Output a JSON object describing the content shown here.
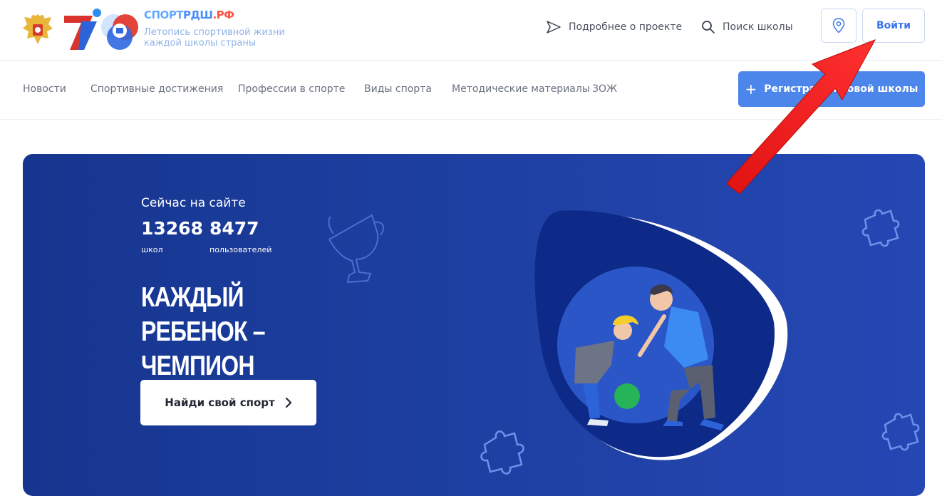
{
  "header": {
    "brand": {
      "part1": "СПОРТ",
      "part2": "РДШ",
      "part3": ".РФ"
    },
    "tagline_line1": "Летопись спортивной жизни",
    "tagline_line2": "каждой школы страны",
    "about_link": "Подробнее о проекте",
    "search_link": "Поиск школы",
    "login_label": "Войти"
  },
  "nav": {
    "items": [
      "Новости",
      "Спортивные достижения",
      "Профессии в спорте",
      "Виды спорта",
      "Методические материалы",
      "ЗОЖ"
    ],
    "register_label": "Регистрация новой школы"
  },
  "hero": {
    "online_label": "Сейчас на сайте",
    "stats": [
      {
        "value": "13268",
        "label": "школ"
      },
      {
        "value": "8477",
        "label": "пользователей"
      }
    ],
    "slogan_line1": "Каждый ребенок –",
    "slogan_line2": "чемпион",
    "cta_label": "Найди свой спорт"
  },
  "colors": {
    "primary": "#4d86eb",
    "hero_bg": "#1d3fa0",
    "annotation_arrow": "#ff1a1a"
  }
}
